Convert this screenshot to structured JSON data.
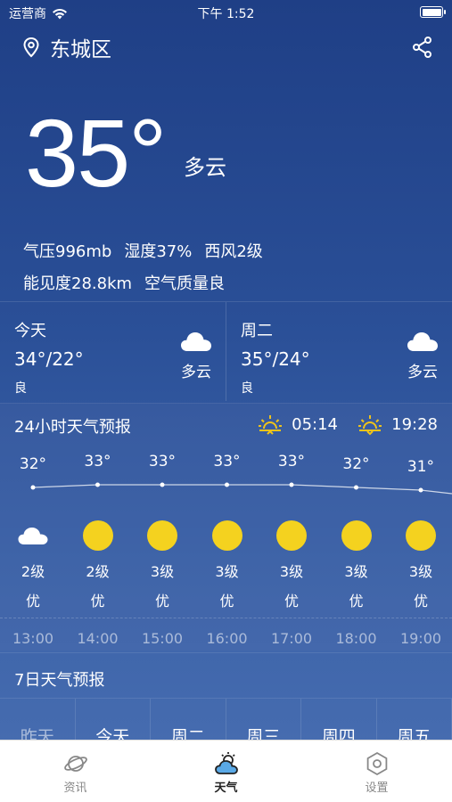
{
  "status": {
    "carrier": "运营商",
    "time": "下午 1:52"
  },
  "header": {
    "city": "东城区"
  },
  "current": {
    "temp": "35°",
    "condition": "多云",
    "pressure": "气压996mb",
    "humidity": "湿度37%",
    "wind": "西风2级",
    "visibility": "能见度28.8km",
    "air": "空气质量良"
  },
  "days": [
    {
      "name": "今天",
      "temp": "34°/22°",
      "aqi": "良",
      "cond": "多云"
    },
    {
      "name": "周二",
      "temp": "35°/24°",
      "aqi": "良",
      "cond": "多云"
    }
  ],
  "hourly": {
    "title": "24小时天气预报",
    "sunrise": "05:14",
    "sunset": "19:28",
    "hours": [
      {
        "temp": "32°",
        "temp_value": 32,
        "icon": "cloud-icon",
        "wind": "2级",
        "aqi": "优",
        "time": "13:00"
      },
      {
        "temp": "33°",
        "temp_value": 33,
        "icon": "sun-icon",
        "wind": "2级",
        "aqi": "优",
        "time": "14:00"
      },
      {
        "temp": "33°",
        "temp_value": 33,
        "icon": "sun-icon",
        "wind": "3级",
        "aqi": "优",
        "time": "15:00"
      },
      {
        "temp": "33°",
        "temp_value": 33,
        "icon": "sun-icon",
        "wind": "3级",
        "aqi": "优",
        "time": "16:00"
      },
      {
        "temp": "33°",
        "temp_value": 33,
        "icon": "sun-icon",
        "wind": "3级",
        "aqi": "优",
        "time": "17:00"
      },
      {
        "temp": "32°",
        "temp_value": 32,
        "icon": "sun-icon",
        "wind": "3级",
        "aqi": "优",
        "time": "18:00"
      },
      {
        "temp": "31°",
        "temp_value": 31,
        "icon": "sun-icon",
        "wind": "3级",
        "aqi": "优",
        "time": "19:00"
      }
    ]
  },
  "weekly": {
    "title": "7日天气预报",
    "days": [
      "昨天",
      "今天",
      "周二",
      "周三",
      "周四",
      "周五"
    ]
  },
  "tabs": [
    {
      "label": "资讯",
      "icon": "planet-icon"
    },
    {
      "label": "天气",
      "icon": "weather-icon"
    },
    {
      "label": "设置",
      "icon": "settings-icon"
    }
  ],
  "colors": {
    "sun": "#f4d21f",
    "cloud": "#ffffff",
    "sun_line": "#f0c419",
    "bg_top": "#1f3f86",
    "bg_bottom": "#4a6fb2"
  }
}
